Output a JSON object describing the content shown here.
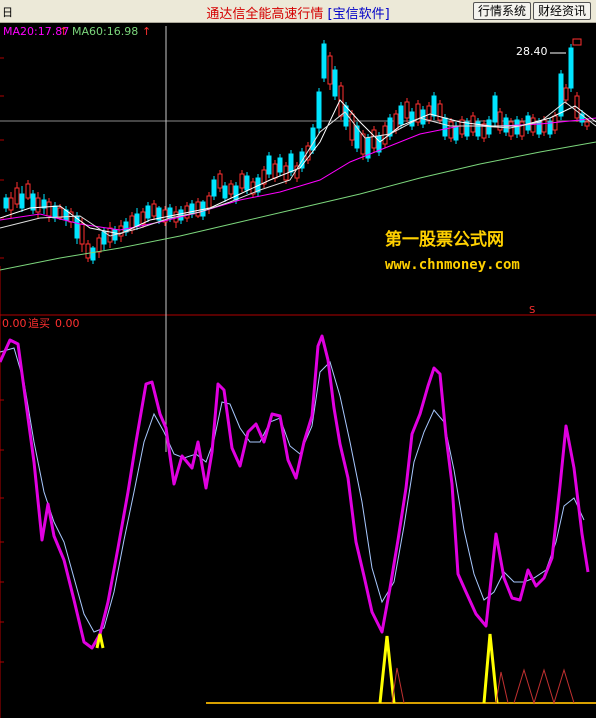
{
  "titlebar": {
    "left_label": "日",
    "title_main": "通达信全能高速行情",
    "title_bracket": "[宝信软件]",
    "btn_quotes": "行情系统",
    "btn_finance": "财经资讯"
  },
  "price_panel": {
    "ma20_label": "MA20:17.87",
    "ma60_label": "MA60:16.98",
    "up_arrow": "↑",
    "high_label": "28.40",
    "marker": "S",
    "watermark_title": "第一股票公式网",
    "watermark_url": "www.chnmoney.com"
  },
  "indicator_panel": {
    "left_value": "0.00",
    "name": "追买",
    "value": "0.00"
  },
  "colors": {
    "up": "#ff3030",
    "down": "#00e5ff",
    "ma_white": "#ffffff",
    "ma_magenta": "#ff00ff",
    "ma_green": "#7cd67c",
    "indicator_main": "#e000e0",
    "indicator_sub": "#a8c8ff",
    "signal_yellow": "#ffff00",
    "signal_red": "#c03030",
    "watermark": "#ffd000"
  },
  "chart_data": {
    "type": "candlestick_with_indicator",
    "price_high_label": 28.4,
    "ma20": 17.87,
    "ma60": 16.98,
    "indicator_value": 0.0
  }
}
